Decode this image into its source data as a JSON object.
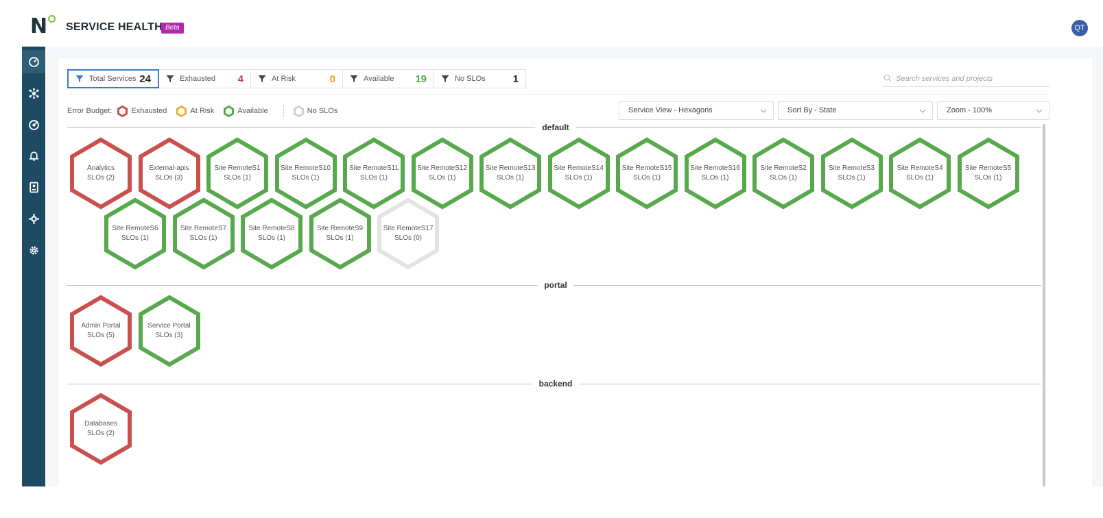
{
  "header": {
    "logo": "N",
    "title": "SERVICE HEALTH",
    "badge": "Beta",
    "avatar": "QT"
  },
  "sidebar": {
    "items": [
      "dashboard-icon",
      "topology-icon",
      "target-icon",
      "bell-icon",
      "report-icon",
      "integration-icon",
      "settings-icon"
    ]
  },
  "filters": [
    {
      "label": "Total Services",
      "count": "24",
      "color": "#222222"
    },
    {
      "label": "Exhausted",
      "count": "4",
      "color": "#d04040"
    },
    {
      "label": "At Risk",
      "count": "0",
      "color": "#e2a400"
    },
    {
      "label": "Available",
      "count": "19",
      "color": "#4caa46"
    },
    {
      "label": "No SLOs",
      "count": "1",
      "color": "#222222"
    }
  ],
  "search": {
    "placeholder": "Search services and projects",
    "value": ""
  },
  "legend": {
    "label": "Error Budget:",
    "items": [
      {
        "label": "Exhausted",
        "color": "#c9504c"
      },
      {
        "label": "At Risk",
        "color": "#e8b339"
      },
      {
        "label": "Available",
        "color": "#58a94d"
      },
      {
        "label": "No SLOs",
        "color": "#cfcfcf"
      }
    ]
  },
  "dropdowns": {
    "view": "Service View - Hexagons",
    "sort": "Sort By - State",
    "zoom": "Zoom - 100%"
  },
  "colors": {
    "exhausted": "#c9504c",
    "available": "#58a94d",
    "none": "#e3e3e3",
    "sidebar": "#1f4a63",
    "accent": "#3a7bc8"
  },
  "sections": [
    {
      "name": "default",
      "services": [
        {
          "name": "Analytics",
          "slos": "SLOs (2)",
          "state": "exhausted"
        },
        {
          "name": "External-apis",
          "slos": "SLOs (3)",
          "state": "exhausted"
        },
        {
          "name": "Site RemoteS1",
          "slos": "SLOs (1)",
          "state": "available"
        },
        {
          "name": "Site RemoteS10",
          "slos": "SLOs (1)",
          "state": "available"
        },
        {
          "name": "Site RemoteS11",
          "slos": "SLOs (1)",
          "state": "available"
        },
        {
          "name": "Site RemoteS12",
          "slos": "SLOs (1)",
          "state": "available"
        },
        {
          "name": "Site RemoteS13",
          "slos": "SLOs (1)",
          "state": "available"
        },
        {
          "name": "Site RemoteS14",
          "slos": "SLOs (1)",
          "state": "available"
        },
        {
          "name": "Site RemoteS15",
          "slos": "SLOs (1)",
          "state": "available"
        },
        {
          "name": "Site RemoteS16",
          "slos": "SLOs (1)",
          "state": "available"
        },
        {
          "name": "Site RemoteS2",
          "slos": "SLOs (1)",
          "state": "available"
        },
        {
          "name": "Site RemoteS3",
          "slos": "SLOs (1)",
          "state": "available"
        },
        {
          "name": "Site RemoteS4",
          "slos": "SLOs (1)",
          "state": "available"
        },
        {
          "name": "Site RemoteS5",
          "slos": "SLOs (1)",
          "state": "available"
        },
        {
          "name": "Site RemoteS6",
          "slos": "SLOs (1)",
          "state": "available"
        },
        {
          "name": "Site RemoteS7",
          "slos": "SLOs (1)",
          "state": "available"
        },
        {
          "name": "Site RemoteS8",
          "slos": "SLOs (1)",
          "state": "available"
        },
        {
          "name": "Site RemoteS9",
          "slos": "SLOs (1)",
          "state": "available"
        },
        {
          "name": "Site RemoteS17",
          "slos": "SLOs (0)",
          "state": "none"
        }
      ]
    },
    {
      "name": "portal",
      "services": [
        {
          "name": "Admin Portal",
          "slos": "SLOs (5)",
          "state": "exhausted"
        },
        {
          "name": "Service Portal",
          "slos": "SLOs (3)",
          "state": "available"
        }
      ]
    },
    {
      "name": "backend",
      "services": [
        {
          "name": "Databases",
          "slos": "SLOs (2)",
          "state": "exhausted"
        }
      ]
    }
  ]
}
